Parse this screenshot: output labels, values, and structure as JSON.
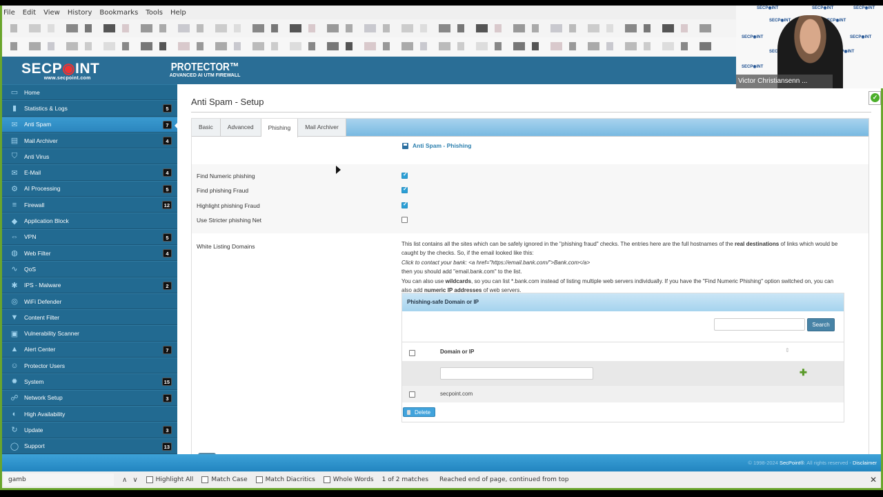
{
  "browser": {
    "menu": [
      "File",
      "Edit",
      "View",
      "History",
      "Bookmarks",
      "Tools",
      "Help"
    ]
  },
  "brand": {
    "logo_text_1": "SECP",
    "logo_dot": "◉",
    "logo_text_2": "INT",
    "logo_url": "www.secpoint.com",
    "product_name": "PROTECTOR™",
    "product_tagline": "ADVANCED AI UTM FIREWALL"
  },
  "sidebar": {
    "items": [
      {
        "label": "Home",
        "icon": "▭",
        "badge": null
      },
      {
        "label": "Statistics & Logs",
        "icon": "▮",
        "badge": "5"
      },
      {
        "label": "Anti Spam",
        "icon": "✉",
        "badge": "7",
        "active": true
      },
      {
        "label": "Mail Archiver",
        "icon": "▤",
        "badge": "4"
      },
      {
        "label": "Anti Virus",
        "icon": "⛉",
        "badge": null
      },
      {
        "label": "E-Mail",
        "icon": "✉",
        "badge": "4"
      },
      {
        "label": "AI Processing",
        "icon": "⚙",
        "badge": "5"
      },
      {
        "label": "Firewall",
        "icon": "≡",
        "badge": "12"
      },
      {
        "label": "Application Block",
        "icon": "◆",
        "badge": null
      },
      {
        "label": "VPN",
        "icon": "⇔",
        "badge": "5"
      },
      {
        "label": "Web Filter",
        "icon": "◍",
        "badge": "4"
      },
      {
        "label": "QoS",
        "icon": "∿",
        "badge": null
      },
      {
        "label": "IPS - Malware",
        "icon": "✱",
        "badge": "2"
      },
      {
        "label": "WiFi Defender",
        "icon": "◎",
        "badge": null
      },
      {
        "label": "Content Filter",
        "icon": "▼",
        "badge": null
      },
      {
        "label": "Vulnerability Scanner",
        "icon": "▣",
        "badge": null
      },
      {
        "label": "Alert Center",
        "icon": "▲",
        "badge": "7"
      },
      {
        "label": "Protector Users",
        "icon": "☺",
        "badge": null
      },
      {
        "label": "System",
        "icon": "✹",
        "badge": "15"
      },
      {
        "label": "Network Setup",
        "icon": "☍",
        "badge": "3"
      },
      {
        "label": "High Availability",
        "icon": "◐",
        "badge": null
      },
      {
        "label": "Update",
        "icon": "↻",
        "badge": "3"
      },
      {
        "label": "Support",
        "icon": "◯",
        "badge": "13"
      }
    ]
  },
  "main": {
    "page_title": "Anti Spam - Setup",
    "tabs": [
      {
        "label": "Basic",
        "active": false
      },
      {
        "label": "Advanced",
        "active": false
      },
      {
        "label": "Phishing",
        "active": true
      },
      {
        "label": "Mail Archiver",
        "active": false
      }
    ],
    "section_title": "Anti Spam - Phishing",
    "options": [
      {
        "label": "Find Numeric phishing",
        "checked": true
      },
      {
        "label": "Find phishing Fraud",
        "checked": true
      },
      {
        "label": "Highlight phishing Fraud",
        "checked": true
      },
      {
        "label": "Use Stricter phishing Net",
        "checked": false
      }
    ],
    "whitelist": {
      "label": "White Listing Domains",
      "desc_1a": "This list contains all the sites which can be safely ignored in the \"phishing fraud\" checks. The entries here are the full hostnames of the ",
      "desc_1b": "real destinations",
      "desc_1c": " of links which would be caught by the checks. So, if the email looked like this:",
      "desc_2": "Click to contact your bank: <a href=\"https://email.bank.com/\">Bank.com</a>",
      "desc_3": "then you should add \"email.bank.com\" to the list.",
      "desc_4a": "You can also use ",
      "desc_4b": "wildcards",
      "desc_4c": ", so you can list *.bank.com instead of listing multiple web servers individually. If you have the \"Find Numeric Phishing\" option switched on, you can also add ",
      "desc_4d": "numeric IP addresses",
      "desc_4e": " of web servers."
    },
    "table": {
      "title": "Phishing-safe Domain or IP",
      "search_value": "",
      "search_label": "Search",
      "column": "Domain or IP",
      "new_entry_value": "",
      "rows": [
        {
          "domain": "secpoint.com",
          "checked": false
        }
      ],
      "delete_label": "Delete"
    }
  },
  "footer": {
    "copyright_pre": "© 1998-2024 ",
    "brand": "SecPoint®",
    "copyright_post": ". All rights reserved - ",
    "disclaimer": "Disclaimer"
  },
  "findbar": {
    "query": "gamb",
    "options": [
      {
        "label": "Highlight All",
        "checked": false
      },
      {
        "label": "Match Case",
        "checked": false
      },
      {
        "label": "Match Diacritics",
        "checked": false
      },
      {
        "label": "Whole Words",
        "checked": false
      }
    ],
    "match_count": "1 of 2 matches",
    "status": "Reached end of page, continued from top"
  },
  "video_overlay": {
    "participant_name": "Victor Christiansenn ..."
  },
  "colors": {
    "sidebar": "#226a91",
    "active_nav": "#3a9ad0",
    "accent": "#2a9fd6",
    "footer": "#2285c0",
    "frame": "#6aa52c"
  }
}
